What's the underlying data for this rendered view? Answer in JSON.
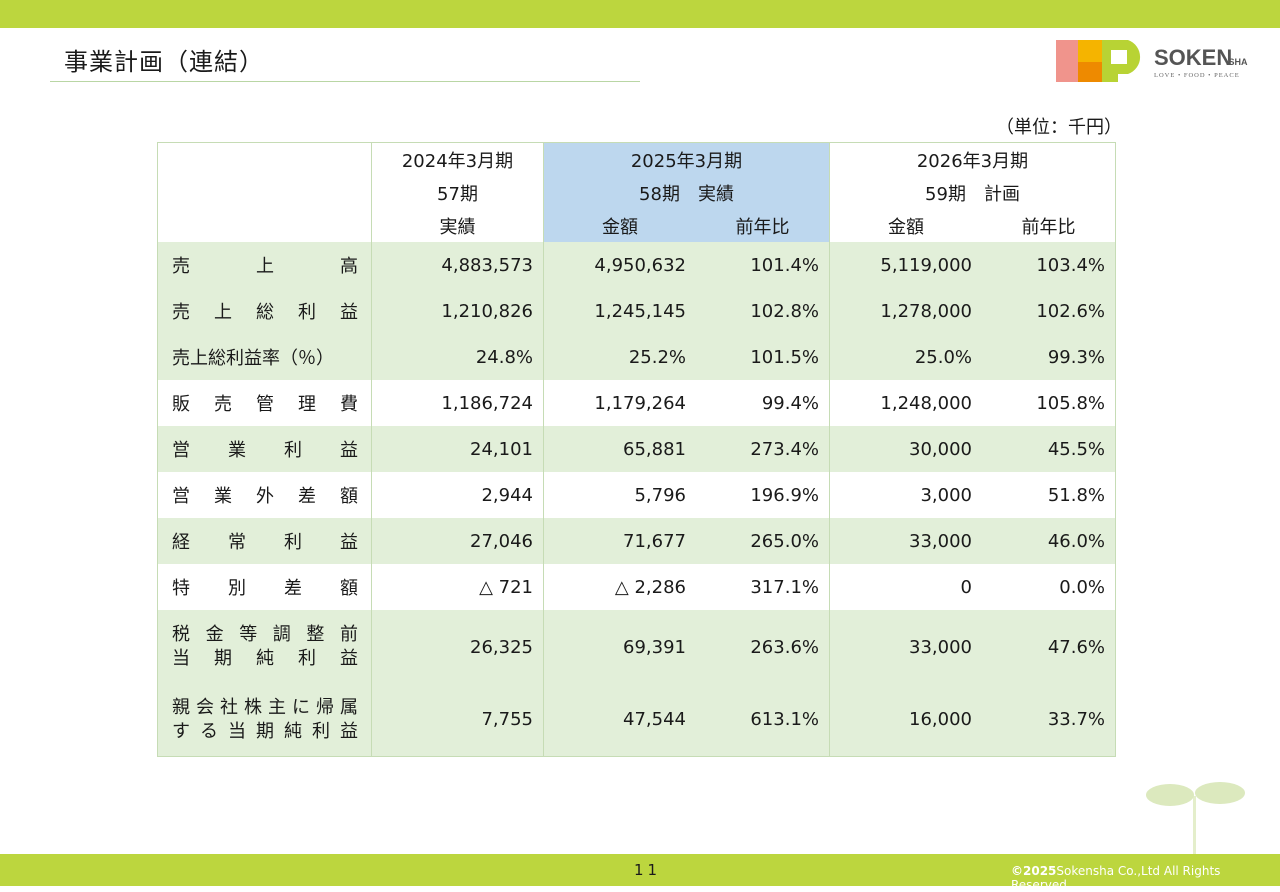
{
  "header": {
    "title": "事業計画（連結）",
    "unit": "（単位：千円）"
  },
  "logo": {
    "name": "SOKEN",
    "suffix": ".SHA",
    "tagline": "LOVE • FOOD • PEACE"
  },
  "columns": {
    "fy2024": {
      "year": "2024年3月期",
      "period": "57期",
      "type": "実績"
    },
    "fy2025": {
      "year": "2025年3月期",
      "period": "58期　実績",
      "amount": "金額",
      "yoy": "前年比"
    },
    "fy2026": {
      "year": "2026年3月期",
      "period": "59期　計画",
      "amount": "金額",
      "yoy": "前年比"
    }
  },
  "rows": [
    {
      "label": [
        "売",
        "上",
        "高"
      ],
      "v": [
        "4,883,573",
        "4,950,632",
        "101.4%",
        "5,119,000",
        "103.4%"
      ]
    },
    {
      "label": [
        "売",
        "上",
        "総",
        "利",
        "益"
      ],
      "v": [
        "1,210,826",
        "1,245,145",
        "102.8%",
        "1,278,000",
        "102.6%"
      ]
    },
    {
      "label_text": "売上総利益率（％）",
      "v": [
        "24.8%",
        "25.2%",
        "101.5%",
        "25.0%",
        "99.3%"
      ]
    },
    {
      "label": [
        "販",
        "売",
        "管",
        "理",
        "費"
      ],
      "v": [
        "1,186,724",
        "1,179,264",
        "99.4%",
        "1,248,000",
        "105.8%"
      ]
    },
    {
      "label": [
        "営",
        "業",
        "利",
        "益"
      ],
      "v": [
        "24,101",
        "65,881",
        "273.4%",
        "30,000",
        "45.5%"
      ]
    },
    {
      "label": [
        "営",
        "業",
        "外",
        "差",
        "額"
      ],
      "v": [
        "2,944",
        "5,796",
        "196.9%",
        "3,000",
        "51.8%"
      ]
    },
    {
      "label": [
        "経",
        "常",
        "利",
        "益"
      ],
      "v": [
        "27,046",
        "71,677",
        "265.0%",
        "33,000",
        "46.0%"
      ]
    },
    {
      "label": [
        "特",
        "別",
        "差",
        "額"
      ],
      "v": [
        "△ 721",
        "△ 2,286",
        "317.1%",
        "0",
        "0.0%"
      ]
    },
    {
      "label_lines": [
        [
          "税",
          "金",
          "等",
          "調",
          "整",
          "前"
        ],
        [
          "当",
          "期",
          "純",
          "利",
          "益"
        ]
      ],
      "v": [
        "26,325",
        "69,391",
        "263.6%",
        "33,000",
        "47.6%"
      ]
    },
    {
      "label_lines": [
        [
          "親",
          "会",
          "社",
          "株",
          "主",
          "に",
          "帰",
          "属"
        ],
        [
          "す",
          "る",
          "当",
          "期",
          "純",
          "利",
          "益"
        ]
      ],
      "v": [
        "7,755",
        "47,544",
        "613.1%",
        "16,000",
        "33.7%"
      ]
    }
  ],
  "footer": {
    "page": "11",
    "copyright_year": "©2025",
    "copyright_text": "Sokensha Co.,Ltd All Rights Reserved."
  },
  "colors": {
    "accent": "#bcd63e",
    "row_green": "#e2efd9",
    "highlight_blue": "#bdd7ee"
  }
}
